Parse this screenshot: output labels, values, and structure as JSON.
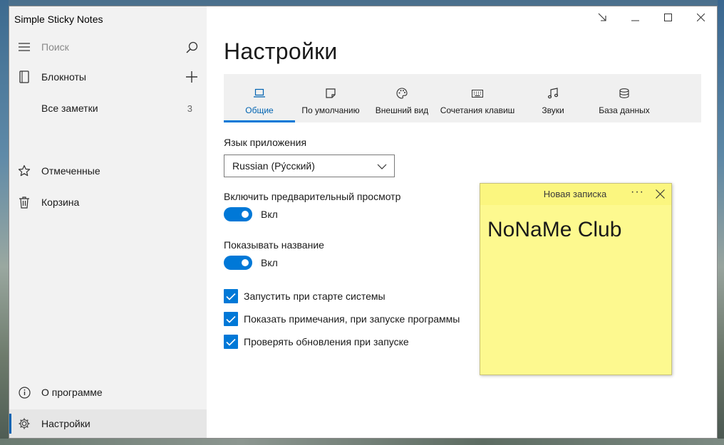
{
  "app": {
    "title": "Simple Sticky Notes"
  },
  "sidebar": {
    "search_placeholder": "Поиск",
    "notebooks_label": "Блокноты",
    "all_notes_label": "Все заметки",
    "all_notes_count": "3",
    "starred_label": "Отмеченные",
    "trash_label": "Корзина",
    "about_label": "О программе",
    "settings_label": "Настройки"
  },
  "main": {
    "title": "Настройки",
    "tabs": [
      {
        "label": "Общие",
        "icon": "laptop-icon",
        "active": true
      },
      {
        "label": "По умолчанию",
        "icon": "note-icon"
      },
      {
        "label": "Внешний вид",
        "icon": "palette-icon"
      },
      {
        "label": "Сочетания клавиш",
        "icon": "keyboard-icon"
      },
      {
        "label": "Звуки",
        "icon": "music-icon"
      },
      {
        "label": "База данных",
        "icon": "database-icon"
      }
    ],
    "language_label": "Язык приложения",
    "language_value": "Russian (Ру́сский)",
    "preview_label": "Включить предварительный просмотр",
    "preview_state": "Вкл",
    "showname_label": "Показывать название",
    "showname_state": "Вкл",
    "checkboxes": [
      {
        "label": "Запустить при старте системы",
        "checked": true
      },
      {
        "label": "Показать примечания, при запуске программы",
        "checked": true
      },
      {
        "label": "Проверять обновления при запуске",
        "checked": true
      }
    ]
  },
  "note": {
    "title": "Новая записка",
    "menu": "···",
    "content": "NoNaMe Club",
    "color": "#fdf98f"
  },
  "colors": {
    "accent": "#0078d7",
    "sidebar_bg": "#f2f2f2"
  }
}
